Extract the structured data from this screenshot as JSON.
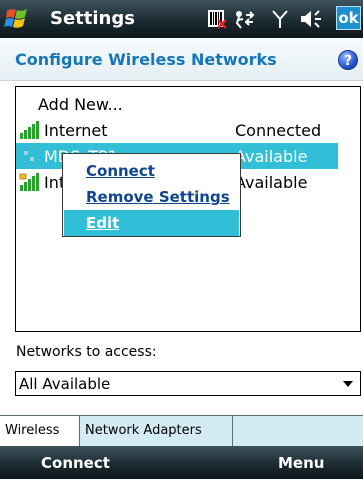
{
  "titlebar": {
    "title": "Settings",
    "ok_label": "ok"
  },
  "header": {
    "title": "Configure Wireless Networks",
    "help_label": "?"
  },
  "network_list": {
    "add_new_label": "Add New...",
    "items": [
      {
        "name": "Internet",
        "status": "Connected",
        "icon": "signal-strength-icon"
      },
      {
        "name": "MDS_TP1",
        "status": "Available",
        "icon": "ad-hoc-network-icon"
      },
      {
        "name": "Internet",
        "status": "Available",
        "icon": "secured-signal-icon"
      }
    ]
  },
  "context_menu": {
    "items": [
      {
        "label": "Connect"
      },
      {
        "label": "Remove Settings"
      },
      {
        "label": "Edit"
      }
    ]
  },
  "access": {
    "label": "Networks to access:",
    "value": "All Available"
  },
  "tabs": [
    {
      "label": "Wireless",
      "active": true
    },
    {
      "label": "Network Adapters",
      "active": false
    }
  ],
  "softkeys": {
    "left": "Connect",
    "right": "Menu"
  },
  "colors": {
    "selection": "#30bfd6",
    "title_text": "#1776b8",
    "menu_text": "#10468f"
  }
}
